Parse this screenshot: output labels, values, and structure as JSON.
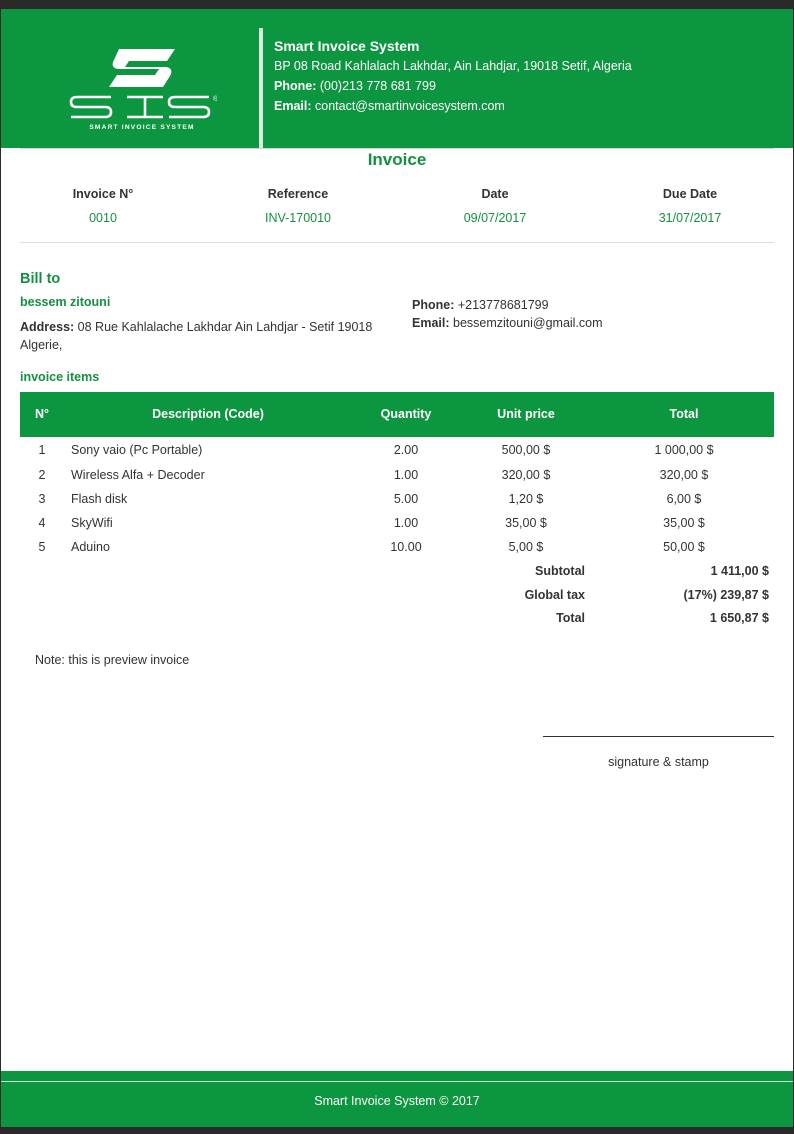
{
  "company": {
    "name": "Smart Invoice System",
    "address": "BP 08 Road Kahlalach Lakhdar, Ain Lahdjar, 19018 Setif, Algeria",
    "phone_label": "Phone:",
    "phone": "(00)213 778 681 799",
    "email_label": "Email:",
    "email": "contact@smartinvoicesystem.com",
    "logo_text": "SIS",
    "logo_tagline": "SMART INVOICE SYSTEM",
    "logo_mark": "®"
  },
  "invoice": {
    "title": "Invoice",
    "fields": [
      {
        "label": "Invoice N°",
        "value": "0010"
      },
      {
        "label": "Reference",
        "value": "INV-170010"
      },
      {
        "label": "Date",
        "value": "09/07/2017"
      },
      {
        "label": "Due Date",
        "value": "31/07/2017"
      }
    ]
  },
  "bill_to": {
    "title": "Bill to",
    "name": "bessem zitouni",
    "address_label": "Address:",
    "address": "08 Rue Kahlalache Lakhdar Ain Lahdjar - Setif 19018 Algerie,",
    "phone_label": "Phone:",
    "phone": "+213778681799",
    "email_label": "Email:",
    "email": "bessemzitouni@gmail.com"
  },
  "items": {
    "title": "invoice items",
    "headers": [
      "N°",
      "Description (Code)",
      "Quantity",
      "Unit price",
      "Total"
    ],
    "rows": [
      {
        "no": "1",
        "desc": "Sony vaio (Pc Portable)",
        "qty": "2.00",
        "unit": "500,00 $",
        "total": "1 000,00 $"
      },
      {
        "no": "2",
        "desc": "Wireless Alfa + Decoder",
        "qty": "1.00",
        "unit": "320,00 $",
        "total": "320,00 $"
      },
      {
        "no": "3",
        "desc": "Flash disk",
        "qty": "5.00",
        "unit": "1,20 $",
        "total": "6,00 $"
      },
      {
        "no": "4",
        "desc": "SkyWifi",
        "qty": "1.00",
        "unit": "35,00 $",
        "total": "35,00 $"
      },
      {
        "no": "5",
        "desc": "Aduino",
        "qty": "10.00",
        "unit": "5,00 $",
        "total": "50,00 $"
      }
    ]
  },
  "totals": [
    {
      "label": "Subtotal",
      "value": "1 411,00 $"
    },
    {
      "label": "Global tax",
      "value": "(17%) 239,87 $"
    },
    {
      "label": "Total",
      "value": "1 650,87 $"
    }
  ],
  "note": "Note: this is preview invoice",
  "signature": "signature & stamp",
  "footer": "Smart Invoice System © 2017"
}
